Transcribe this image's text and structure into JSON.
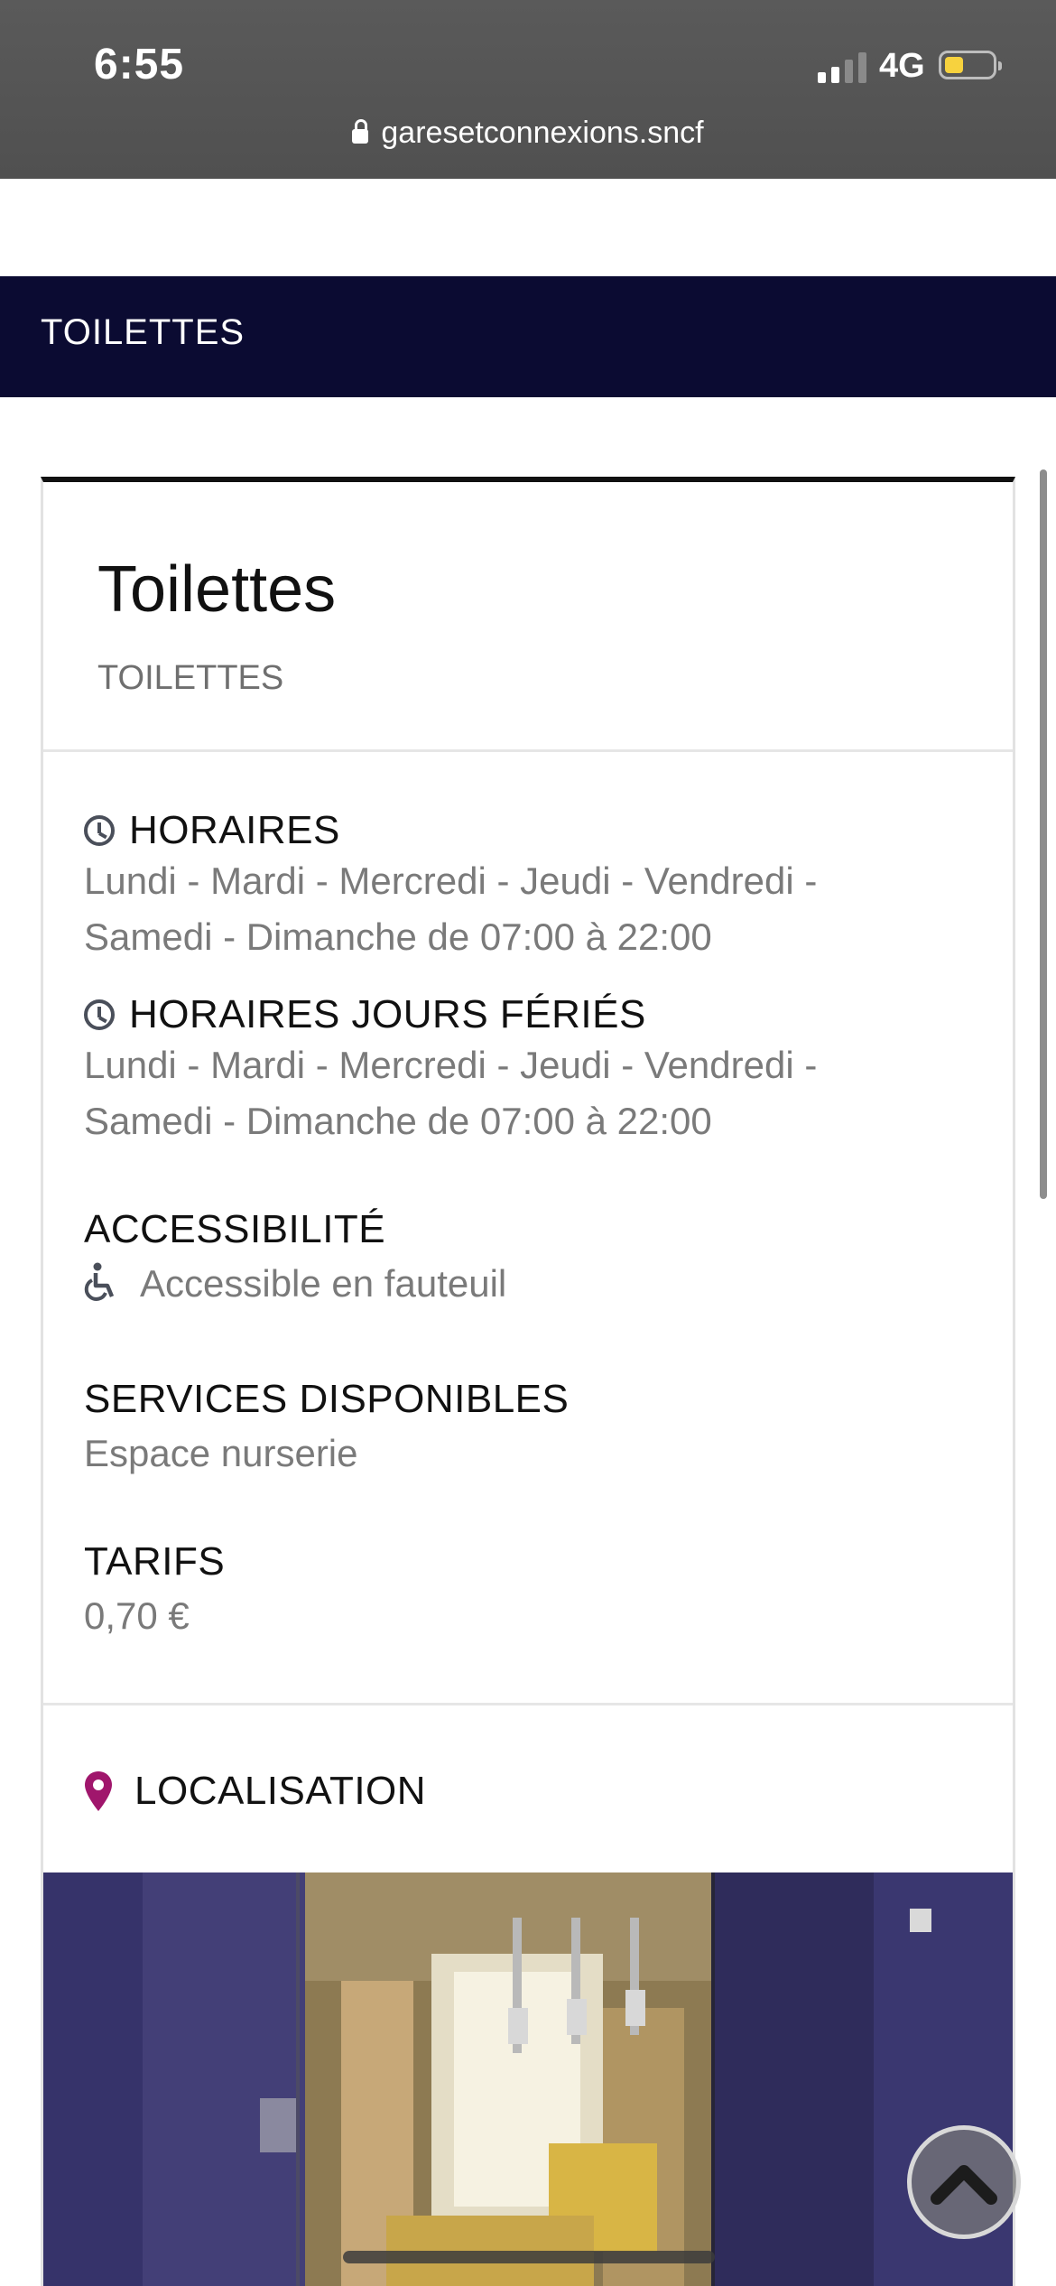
{
  "status_bar": {
    "time": "6:55",
    "network": "4G",
    "signal_bars_active": 2,
    "signal_bars_total": 4,
    "battery_level": 0.3,
    "battery_color": "#f7d23e"
  },
  "browser": {
    "url": "garesetconnexions.sncf"
  },
  "header_band": {
    "title": "TOILETTES",
    "background": "#0b0b32"
  },
  "card": {
    "title": "Toilettes",
    "subtitle": "TOILETTES",
    "hours": {
      "label": "HORAIRES",
      "line1": "Lundi - Mardi - Mercredi - Jeudi - Vendredi -",
      "line2": "Samedi - Dimanche de 07:00 à 22:00"
    },
    "holiday_hours": {
      "label": "HORAIRES JOURS FÉRIÉS",
      "line1": "Lundi - Mardi - Mercredi - Jeudi - Vendredi -",
      "line2": "Samedi - Dimanche de 07:00 à 22:00"
    },
    "accessibility": {
      "label": "ACCESSIBILITÉ",
      "value": "Accessible en fauteuil"
    },
    "services": {
      "label": "SERVICES DISPONIBLES",
      "value": "Espace nurserie"
    },
    "rates": {
      "label": "TARIFS",
      "value": "0,70 €"
    },
    "location": {
      "label": "LOCALISATION",
      "pin_color": "#a0166c"
    }
  },
  "icons": {
    "clock": "clock-icon",
    "wheelchair": "wheelchair-icon",
    "pin": "map-pin-icon",
    "scroll_top": "chevron-up-icon",
    "lock": "lock-icon"
  }
}
